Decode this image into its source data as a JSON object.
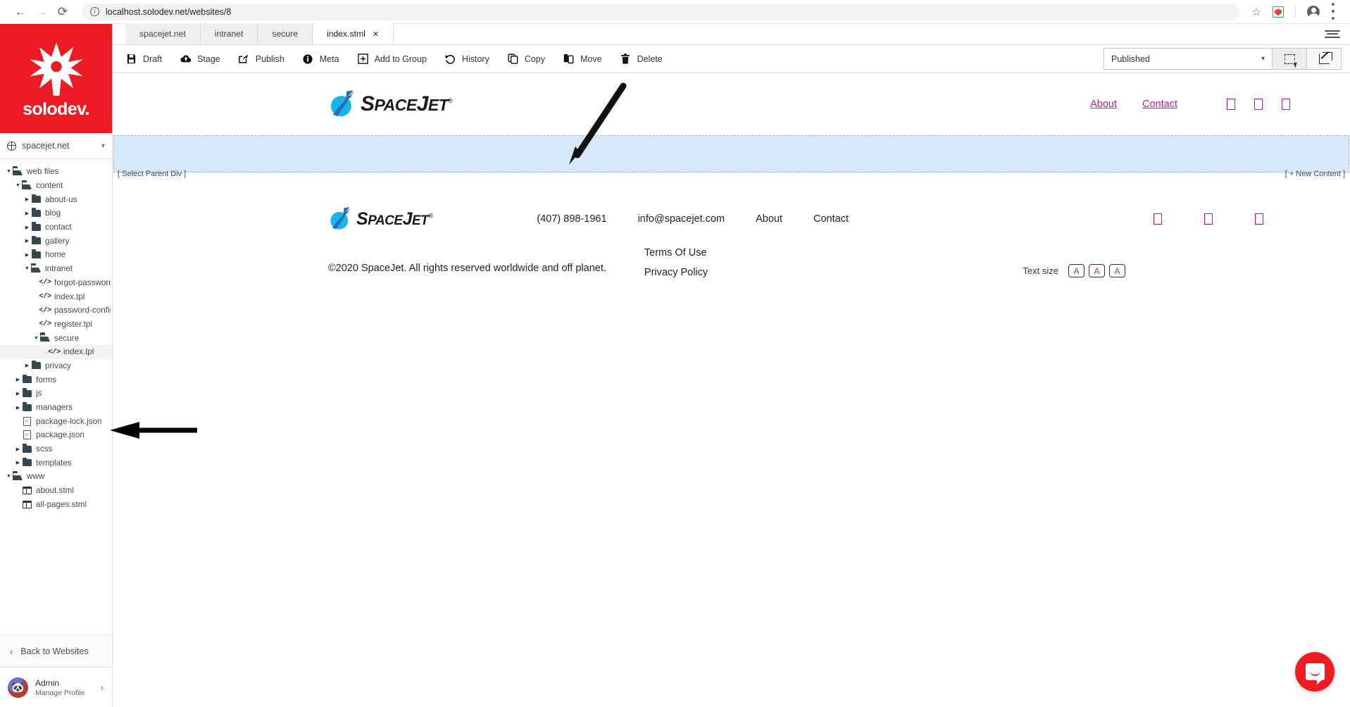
{
  "browser": {
    "back_icon": "back-arrow-icon",
    "forward_icon": "forward-arrow-icon",
    "reload_icon": "reload-icon",
    "url": "localhost.solodev.net/websites/8",
    "site_info_icon": "site-info-icon",
    "bookmark_icon": "star-icon",
    "extension_icon": "extension-icon",
    "profile_icon": "profile-avatar-icon",
    "menu_icon": "chrome-menu-icon"
  },
  "sidebar": {
    "brand": "solodev.",
    "site_selector": {
      "name": "spacejet.net",
      "icon": "globe-icon",
      "chevron": "chevron-down-icon"
    },
    "tree": [
      {
        "label": "web files",
        "depth": 0,
        "type": "folder-open",
        "twisty": "open",
        "selected": false
      },
      {
        "label": "content",
        "depth": 1,
        "type": "folder-open",
        "twisty": "open",
        "selected": false
      },
      {
        "label": "about-us",
        "depth": 2,
        "type": "folder",
        "twisty": "closed",
        "selected": false
      },
      {
        "label": "blog",
        "depth": 2,
        "type": "folder",
        "twisty": "closed",
        "selected": false
      },
      {
        "label": "contact",
        "depth": 2,
        "type": "folder",
        "twisty": "closed",
        "selected": false
      },
      {
        "label": "gallery",
        "depth": 2,
        "type": "folder",
        "twisty": "closed",
        "selected": false
      },
      {
        "label": "home",
        "depth": 2,
        "type": "folder",
        "twisty": "closed",
        "selected": false
      },
      {
        "label": "intranet",
        "depth": 2,
        "type": "folder-open",
        "twisty": "open",
        "selected": false
      },
      {
        "label": "forgot-password.tpl",
        "depth": 3,
        "type": "code",
        "twisty": "none",
        "selected": false
      },
      {
        "label": "index.tpl",
        "depth": 3,
        "type": "code",
        "twisty": "none",
        "selected": false
      },
      {
        "label": "password-confirmation.tpl",
        "depth": 3,
        "type": "code",
        "twisty": "none",
        "selected": false
      },
      {
        "label": "register.tpl",
        "depth": 3,
        "type": "code",
        "twisty": "none",
        "selected": false
      },
      {
        "label": "secure",
        "depth": 3,
        "type": "folder-open",
        "twisty": "open",
        "selected": false
      },
      {
        "label": "index.tpl",
        "depth": 4,
        "type": "code",
        "twisty": "none",
        "selected": true
      },
      {
        "label": "privacy",
        "depth": 2,
        "type": "folder",
        "twisty": "closed",
        "selected": false
      },
      {
        "label": "forms",
        "depth": 1,
        "type": "folder",
        "twisty": "closed",
        "selected": false
      },
      {
        "label": "js",
        "depth": 1,
        "type": "folder",
        "twisty": "closed",
        "selected": false
      },
      {
        "label": "managers",
        "depth": 1,
        "type": "folder",
        "twisty": "closed",
        "selected": false
      },
      {
        "label": "package-lock.json",
        "depth": 1,
        "type": "file",
        "twisty": "none",
        "selected": false
      },
      {
        "label": "package.json",
        "depth": 1,
        "type": "file",
        "twisty": "none",
        "selected": false
      },
      {
        "label": "scss",
        "depth": 1,
        "type": "folder",
        "twisty": "closed",
        "selected": false
      },
      {
        "label": "templates",
        "depth": 1,
        "type": "folder",
        "twisty": "closed",
        "selected": false
      },
      {
        "label": "www",
        "depth": 0,
        "type": "folder-open",
        "twisty": "open",
        "selected": false
      },
      {
        "label": "about.stml",
        "depth": 1,
        "type": "page",
        "twisty": "none",
        "selected": false
      },
      {
        "label": "all-pages.stml",
        "depth": 1,
        "type": "page",
        "twisty": "none",
        "selected": false
      }
    ],
    "back_to_websites": "Back to Websites",
    "back_chevron_icon": "chevron-left-icon",
    "profile": {
      "name": "Admin",
      "subtitle": "Manage Profile",
      "avatar_icon": "panda-avatar-icon",
      "chevron_icon": "chevron-right-icon"
    }
  },
  "tabs": [
    {
      "label": "spacejet.net",
      "active": false,
      "closable": false
    },
    {
      "label": "intranet",
      "active": false,
      "closable": false
    },
    {
      "label": "secure",
      "active": false,
      "closable": false
    },
    {
      "label": "index.stml",
      "active": true,
      "closable": true,
      "close_glyph": "✕"
    }
  ],
  "toolbar": {
    "items": [
      {
        "label": "Draft",
        "icon": "save-icon",
        "glyph": "💾"
      },
      {
        "label": "Stage",
        "icon": "cloud-up-icon",
        "glyph": "▲"
      },
      {
        "label": "Publish",
        "icon": "share-icon",
        "glyph": "➦"
      },
      {
        "label": "Meta",
        "icon": "info-icon",
        "glyph": "ℹ"
      },
      {
        "label": "Add to Group",
        "icon": "plus-box-icon",
        "glyph": "⊞"
      },
      {
        "label": "History",
        "icon": "history-icon",
        "glyph": "↺"
      },
      {
        "label": "Copy",
        "icon": "copy-icon",
        "glyph": "❐"
      },
      {
        "label": "Move",
        "icon": "move-icon",
        "glyph": "❐"
      },
      {
        "label": "Delete",
        "icon": "trash-icon",
        "glyph": "🗑"
      }
    ],
    "status_select": {
      "value": "Published",
      "chevron_icon": "chevron-down-icon",
      "options": [
        "Published"
      ]
    },
    "select_region_icon": "marquee-select-icon",
    "open_external_icon": "open-external-icon",
    "panel_menu_icon": "hamburger-menu-icon"
  },
  "website": {
    "logo": {
      "text_primary": "S",
      "text_rest": "PACE",
      "text_j": "J",
      "text_et": "ET",
      "registered": "®",
      "full": "SPACEJET"
    },
    "header_nav": [
      {
        "label": "About",
        "color": "#c2188d"
      },
      {
        "label": "Contact",
        "color": "#c2188d"
      }
    ],
    "header_social_icons": [
      "social-box-icon-1",
      "social-box-icon-2",
      "social-box-icon-3"
    ],
    "editor_band": {
      "select_parent": "[ Select Parent Div ]",
      "new_content": "[ + New Content ]",
      "background": "#d6e8fb"
    },
    "footer": {
      "phone": "(407) 898-1961",
      "email": "info@spacejet.com",
      "links": [
        {
          "label": "About"
        },
        {
          "label": "Contact"
        }
      ],
      "social_icons": [
        "social-box-icon-1",
        "social-box-icon-2",
        "social-box-icon-3"
      ],
      "copyright": "©2020 SpaceJet. All rights reserved worldwide and off planet.",
      "legal": [
        {
          "label": "Terms Of Use"
        },
        {
          "label": "Privacy Policy"
        }
      ],
      "text_size": {
        "label": "Text size",
        "buttons": [
          "A",
          "A",
          "A"
        ],
        "color": "#c2188d"
      }
    }
  },
  "chat_widget": {
    "icon": "chat-bubble-icon",
    "color": "#f01c22"
  },
  "annotations": [
    {
      "name": "pen-stroke-annotation"
    },
    {
      "name": "arrow-pointing-to-index-tpl"
    }
  ]
}
